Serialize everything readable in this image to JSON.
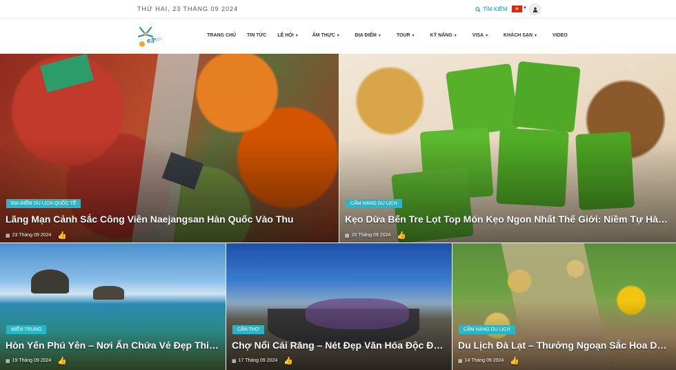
{
  "header": {
    "date": "THỨ HAI, 23 THÁNG 09 2024",
    "search_label": "TÌM KIẾM",
    "search_icon": "search-icon",
    "language_flag": "vietnam-flag-icon",
    "account_icon": "user-icon"
  },
  "logo": {
    "text": "TADI"
  },
  "nav": {
    "items": [
      {
        "label": "TRANG CHỦ",
        "dropdown": false
      },
      {
        "label": "TIN TỨC",
        "dropdown": false
      },
      {
        "label": "LỄ HỘI",
        "dropdown": true
      },
      {
        "label": "ẨM THỰC",
        "dropdown": true
      },
      {
        "label": "ĐỊA ĐIỂM",
        "dropdown": true
      },
      {
        "label": "TOUR",
        "dropdown": true
      },
      {
        "label": "KỸ NĂNG",
        "dropdown": true
      },
      {
        "label": "VISA",
        "dropdown": true
      },
      {
        "label": "KHÁCH SẠN",
        "dropdown": true
      },
      {
        "label": "VIDEO",
        "dropdown": false
      }
    ]
  },
  "cards": [
    {
      "category": "ĐỊA ĐIỂM DU LỊCH QUỐC TẾ",
      "title": "Lãng Mạn Cảnh Sắc Công Viên Naejangsan Hàn Quốc Vào Thu",
      "date": "23 Tháng 09 2024"
    },
    {
      "category": "CẨM NANG DU LỊCH",
      "title": "Kẹo Dừa Bến Tre Lọt Top Món Kẹo Ngon Nhất Thế Giới: Niềm Tự Hào Của...",
      "date": "20 Tháng 09 2024"
    },
    {
      "category": "MIỀN TRUNG",
      "title": "Hòn Yến Phú Yên – Nơi Ẩn Chứa Vẻ Đẹp Thiên...",
      "date": "19 Tháng 09 2024"
    },
    {
      "category": "CẦN THƠ",
      "title": "Chợ Nổi Cái Răng – Nét Đẹp Văn Hóa Độc Đáo...",
      "date": "17 Tháng 09 2024"
    },
    {
      "category": "CẨM NANG DU LỊCH",
      "title": "Du Lịch Đà Lạt – Thưởng Ngoạn Sắc Hoa Dã Qu...",
      "date": "14 Tháng 09 2024"
    }
  ],
  "colors": {
    "accent": "#2bb5c7",
    "link": "#1a8fbf"
  }
}
